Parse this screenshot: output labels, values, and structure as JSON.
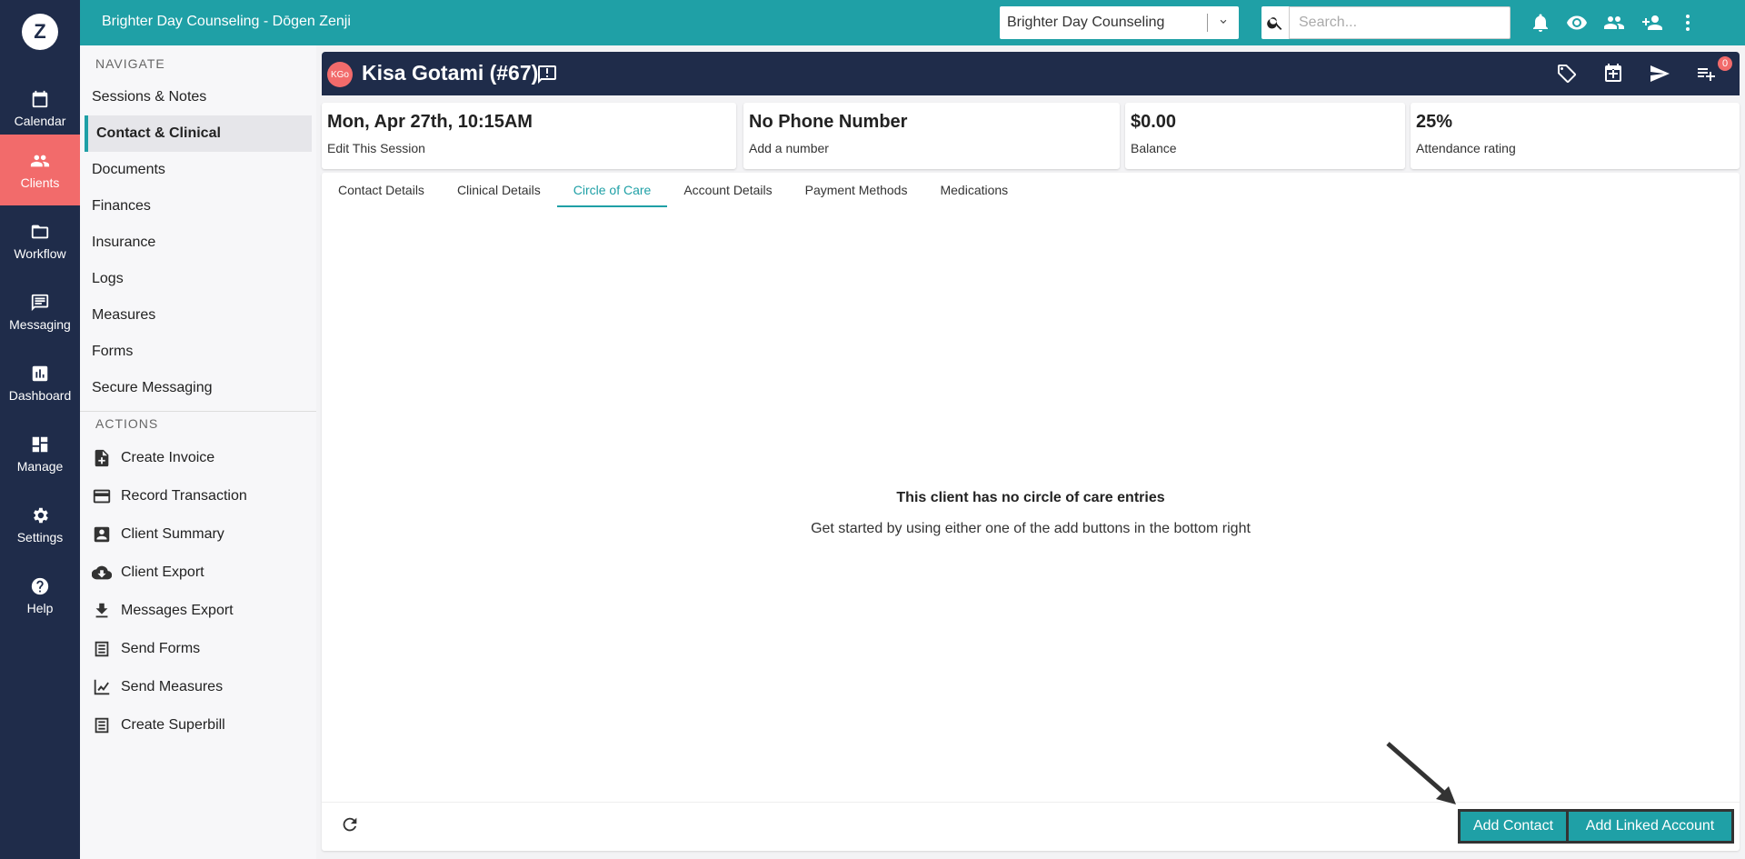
{
  "rail": {
    "logo": "Z",
    "items": [
      {
        "label": "Calendar",
        "icon": "calendar-icon"
      },
      {
        "label": "Clients",
        "icon": "people-icon"
      },
      {
        "label": "Workflow",
        "icon": "folder-icon"
      },
      {
        "label": "Messaging",
        "icon": "message-icon"
      },
      {
        "label": "Dashboard",
        "icon": "bar-chart-icon"
      },
      {
        "label": "Manage",
        "icon": "dashboard-icon"
      },
      {
        "label": "Settings",
        "icon": "gear-icon"
      },
      {
        "label": "Help",
        "icon": "help-icon"
      }
    ],
    "active_color": "#f26b6b",
    "bg_color": "#1f2c4a"
  },
  "topbar": {
    "title": "Brighter Day Counseling - Dōgen Zenji",
    "org_select": "Brighter Day Counseling",
    "search_placeholder": "Search...",
    "accent_color": "#1fa0a6"
  },
  "subnav": {
    "navigate_heading": "NAVIGATE",
    "links": [
      "Sessions & Notes",
      "Contact & Clinical",
      "Documents",
      "Finances",
      "Insurance",
      "Logs",
      "Measures",
      "Forms",
      "Secure Messaging"
    ],
    "active_link": "Contact & Clinical",
    "actions_heading": "ACTIONS",
    "actions": [
      "Create Invoice",
      "Record Transaction",
      "Client Summary",
      "Client Export",
      "Messages Export",
      "Send Forms",
      "Send Measures",
      "Create Superbill"
    ]
  },
  "client": {
    "initials": "KGo",
    "name": "Kisa Gotami (#67)",
    "notification_count": "0"
  },
  "cards": [
    {
      "value": "Mon, Apr 27th, 10:15AM",
      "label": "Edit This Session"
    },
    {
      "value": "No Phone Number",
      "label": "Add a number"
    },
    {
      "value": "$0.00",
      "label": "Balance"
    },
    {
      "value": "25%",
      "label": "Attendance rating"
    }
  ],
  "tabs": [
    "Contact Details",
    "Clinical Details",
    "Circle of Care",
    "Account Details",
    "Payment Methods",
    "Medications"
  ],
  "active_tab": "Circle of Care",
  "empty_state": {
    "title": "This client has no circle of care entries",
    "subtitle": "Get started by using either one of the add buttons in the bottom right"
  },
  "buttons": {
    "add_contact": "Add Contact",
    "add_linked_account": "Add Linked Account"
  }
}
